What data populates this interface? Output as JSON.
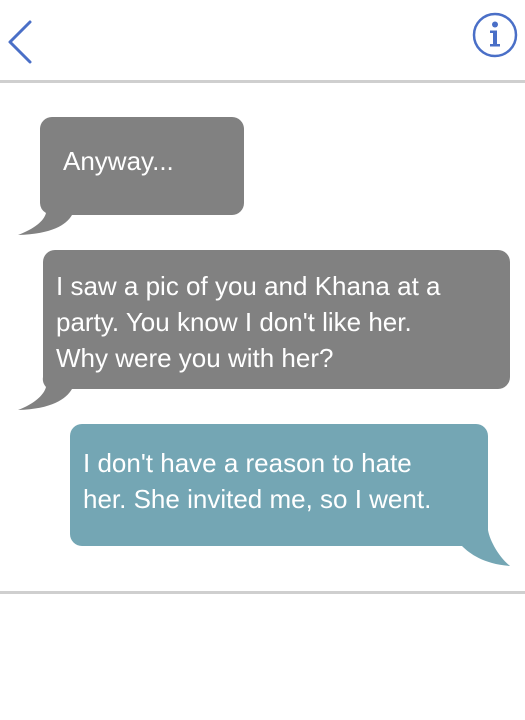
{
  "header": {
    "back_icon": "chevron-left-icon",
    "info_icon": "info-icon",
    "accent_color": "#4a6fc7"
  },
  "messages": [
    {
      "direction": "incoming",
      "text": "Anyway...",
      "color": "#818181"
    },
    {
      "direction": "incoming",
      "text": "I saw a pic of you and Khana at a\nparty. You know I don't like her.\nWhy were you with her?",
      "color": "#818181"
    },
    {
      "direction": "outgoing",
      "text": "I don't have a reason to hate\nher. She invited me, so I went.",
      "color": "#74a6b4"
    }
  ]
}
